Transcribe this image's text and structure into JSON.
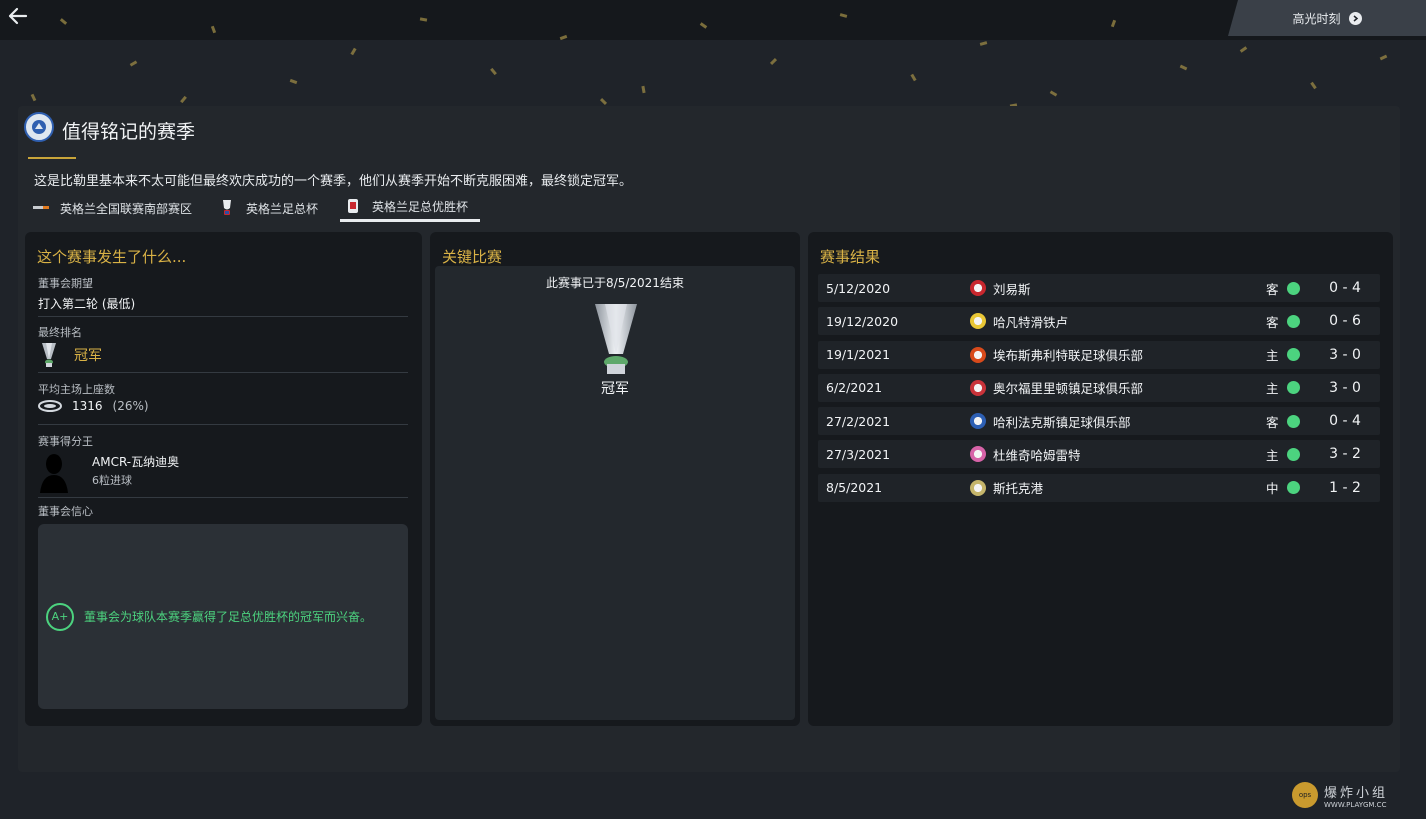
{
  "header": {
    "highlights_label": "高光时刻"
  },
  "page": {
    "title": "值得铭记的赛季",
    "description": "这是比勒里基本来不太可能但最终欢庆成功的一个赛季，他们从赛季开始不断克服困难，最终锁定冠军。"
  },
  "tabs": [
    {
      "label": "英格兰全国联赛南部赛区",
      "icon": "league-logo-icon"
    },
    {
      "label": "英格兰足总杯",
      "icon": "fa-cup-icon"
    },
    {
      "label": "英格兰足总优胜杯",
      "icon": "fa-trophy-icon"
    }
  ],
  "summary": {
    "title": "这个赛事发生了什么...",
    "board_expectation_label": "董事会期望",
    "board_expectation_value": "打入第二轮 (最低)",
    "final_position_label": "最终排名",
    "final_position_value": "冠军",
    "avg_attendance_label": "平均主场上座数",
    "avg_attendance_value": "1316",
    "avg_attendance_pct": "(26%)",
    "top_scorer_label": "赛事得分王",
    "top_scorer_name": "AMCR-瓦纳迪奥",
    "top_scorer_goals": "6粒进球",
    "board_confidence_label": "董事会信心",
    "board_confidence_grade": "A+",
    "board_confidence_text": "董事会为球队本赛季赢得了足总优胜杯的冠军而兴奋。"
  },
  "key_match": {
    "title": "关键比赛",
    "ended_text": "此赛事已于8/5/2021结束",
    "result_text": "冠军"
  },
  "results": {
    "title": "赛事结果",
    "rows": [
      {
        "date": "5/12/2020",
        "team": "刘易斯",
        "venue": "客",
        "score": "0 - 4",
        "badge_color": "#c8272e"
      },
      {
        "date": "19/12/2020",
        "team": "哈凡特滑铁卢",
        "venue": "客",
        "score": "0 - 6",
        "badge_color": "#e9c736"
      },
      {
        "date": "19/1/2021",
        "team": "埃布斯弗利特联足球俱乐部",
        "venue": "主",
        "score": "3 - 0",
        "badge_color": "#d84a1b"
      },
      {
        "date": "6/2/2021",
        "team": "奥尔福里里顿镇足球俱乐部",
        "venue": "主",
        "score": "3 - 0",
        "badge_color": "#c9333a"
      },
      {
        "date": "27/2/2021",
        "team": "哈利法克斯镇足球俱乐部",
        "venue": "客",
        "score": "0 - 4",
        "badge_color": "#2d5fb3"
      },
      {
        "date": "27/3/2021",
        "team": "杜维奇哈姆雷特",
        "venue": "主",
        "score": "3 - 2",
        "badge_color": "#d763a8"
      },
      {
        "date": "8/5/2021",
        "team": "斯托克港",
        "venue": "中",
        "score": "1 - 2",
        "badge_color": "#c5b56b"
      }
    ]
  },
  "watermark": {
    "text": "爆炸小组",
    "url": "WWW.PLAYGM.CC"
  },
  "colors": {
    "accent_gold": "#d9b246",
    "win_green": "#4cd37f"
  }
}
